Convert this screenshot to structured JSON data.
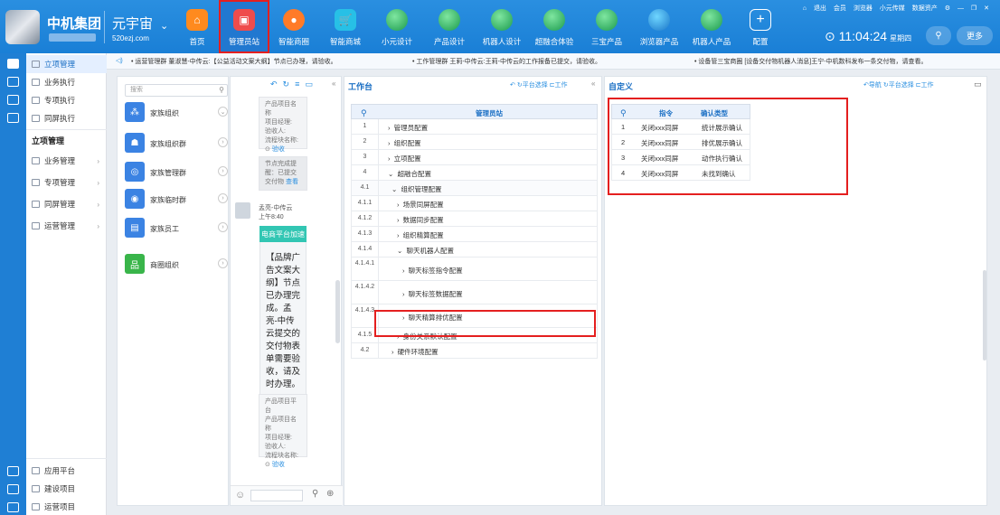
{
  "header": {
    "brand": "中机集团",
    "site": "元宇宙",
    "site_url": "520ezj.com",
    "nav": [
      {
        "label": "首页",
        "icon": "home-icon"
      },
      {
        "label": "管理员站",
        "icon": "admin-station-icon"
      },
      {
        "label": "智能商圈",
        "icon": "smart-mall-icon"
      },
      {
        "label": "智能商城",
        "icon": "cart-icon"
      },
      {
        "label": "小元设计",
        "icon": "globe-icon"
      },
      {
        "label": "产品设计",
        "icon": "globe-icon"
      },
      {
        "label": "机器人设计",
        "icon": "globe-icon"
      },
      {
        "label": "超融合体验",
        "icon": "globe-icon"
      },
      {
        "label": "三宝产品",
        "icon": "globe-icon"
      },
      {
        "label": "浏览器产品",
        "icon": "browser-icon"
      },
      {
        "label": "机器人产品",
        "icon": "globe-icon"
      },
      {
        "label": "配置",
        "icon": "plus-icon"
      }
    ],
    "top_links": [
      "退出",
      "会员",
      "浏览器",
      "小元传媒",
      "数据资产"
    ],
    "time": "11:04:24",
    "weekday": "星期四",
    "more_label": "更多"
  },
  "sidebar": {
    "items": [
      "立项管理",
      "业务执行",
      "专项执行",
      "同屏执行"
    ],
    "section_title": "立项管理",
    "groups": [
      "业务管理",
      "专项管理",
      "同屏管理",
      "运营管理"
    ],
    "bottom": [
      "应用平台",
      "建设项目",
      "运营项目"
    ]
  },
  "notices": [
    "• 运营管理群 董淑慧-中传云:【公益活动文案大纲】节点已办理，请验收。",
    "• 工作管理群 王莉-中传云:王莉-中传云的工作报备已提交，请验收。",
    "• 设备管三宝商圈 [设备交付物机器人消息]王宁-中机数科发布一条交付物，请查看。"
  ],
  "org": {
    "search_placeholder": "搜索",
    "items": [
      "家族组织",
      "家族组织群",
      "家族管理群",
      "家族临时群",
      "家族员工",
      "商圈组织"
    ]
  },
  "chat": {
    "card1": [
      "产品项目名称",
      "项目经理:",
      "验收人:",
      "流程块名称:"
    ],
    "accept": "验收",
    "card2": [
      "节点完成提",
      "醒：已提交",
      "交付物"
    ],
    "view": "查看",
    "sender": "孟亮-中传云",
    "sender_time": "上午8:40",
    "tag": "电商平台加速",
    "message": "【品牌广告文案大纲】节点已办理完成。孟亮-中传云提交的交付物表单需要验收，请及时办理。",
    "card3": [
      "产品项目平台",
      "产品项目名称",
      "项目经理:",
      "验收人:",
      "流程块名称:"
    ]
  },
  "workspace": {
    "title": "工作台",
    "actions": [
      "平台选择",
      "工作"
    ],
    "column": "管理员站",
    "rows": [
      {
        "idx": "1",
        "label": "管理员配置"
      },
      {
        "idx": "2",
        "label": "组织配置"
      },
      {
        "idx": "3",
        "label": "立项配置"
      },
      {
        "idx": "4",
        "label": "超融合配置"
      },
      {
        "idx": "4.1",
        "label": "组织管理配置"
      },
      {
        "idx": "4.1.1",
        "label": "场景同屏配置"
      },
      {
        "idx": "4.1.2",
        "label": "数据同步配置"
      },
      {
        "idx": "4.1.3",
        "label": "组织精算配置"
      },
      {
        "idx": "4.1.4",
        "label": "聊天机器人配置"
      },
      {
        "idx": "4.1.4.1",
        "label": "聊天标签指令配置"
      },
      {
        "idx": "4.1.4.2",
        "label": "聊天标签数据配置"
      },
      {
        "idx": "4.1.4.3",
        "label": "聊天精算排优配置"
      },
      {
        "idx": "4.1.5",
        "label": "身份关系默认配置"
      },
      {
        "idx": "4.2",
        "label": "硬件环境配置"
      }
    ]
  },
  "custom": {
    "title": "自定义",
    "actions": [
      "导航",
      "平台选择",
      "工作"
    ],
    "headers": [
      "指令",
      "确认类型"
    ],
    "rows": [
      {
        "idx": "1",
        "cmd": "关闭xxx同屏",
        "type": "统计展示确认"
      },
      {
        "idx": "2",
        "cmd": "关闭xxx同屏",
        "type": "排优展示确认"
      },
      {
        "idx": "3",
        "cmd": "关闭xxx同屏",
        "type": "动作执行确认"
      },
      {
        "idx": "4",
        "cmd": "关闭xxx同屏",
        "type": "未找到确认"
      }
    ]
  }
}
